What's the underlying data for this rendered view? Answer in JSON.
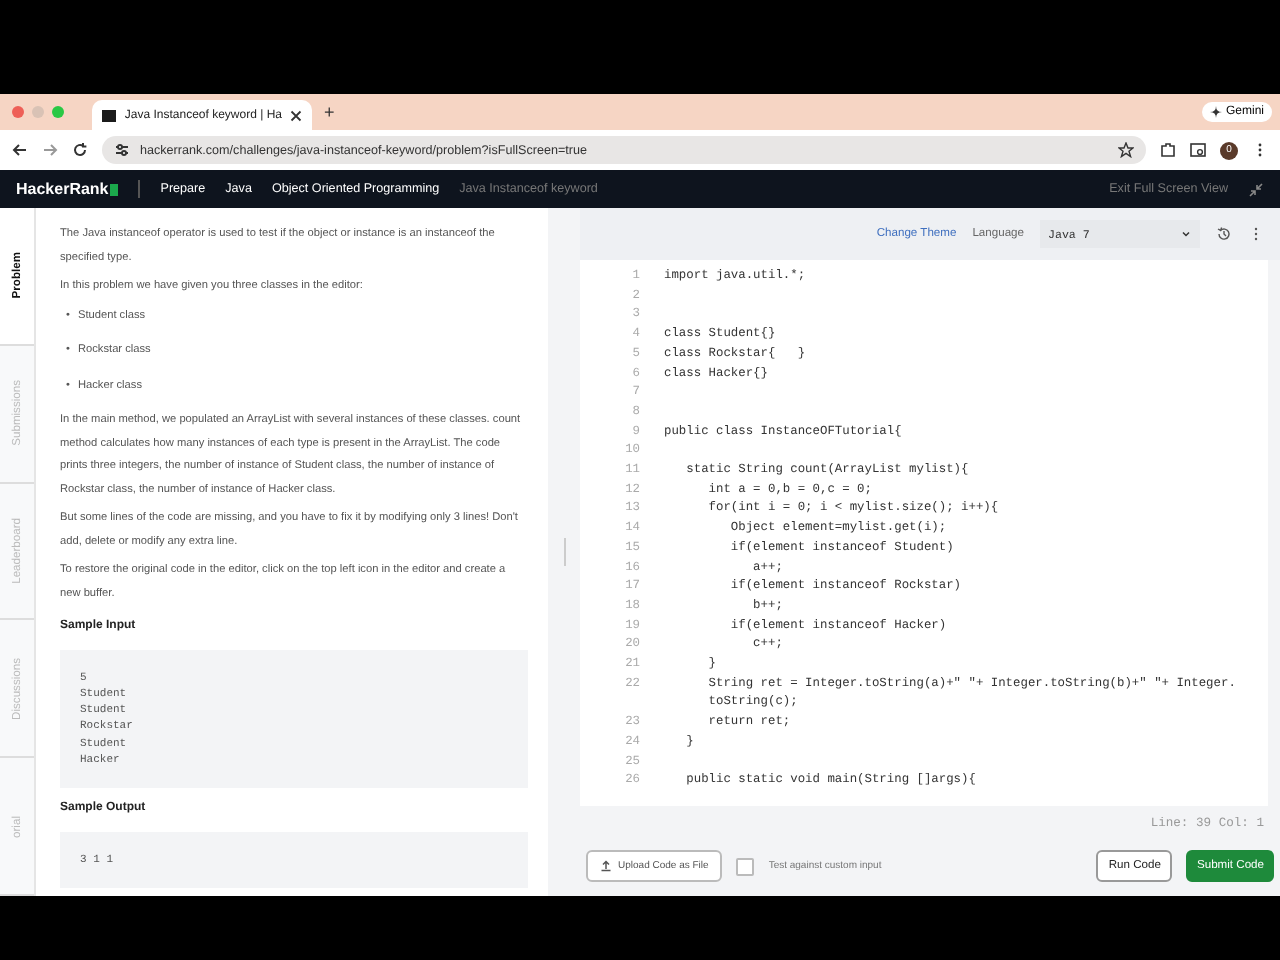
{
  "browser": {
    "tab_title": "Java Instanceof keyword | Ha",
    "new_tab": "+",
    "gemini": "Gemini",
    "url": "hackerrank.com/challenges/java-instanceof-keyword/problem?isFullScreen=true",
    "profile": "0"
  },
  "nav": {
    "logo": "HackerRank",
    "crumbs": [
      {
        "label": "Prepare",
        "current": false
      },
      {
        "label": "Java",
        "current": false
      },
      {
        "label": "Object Oriented Programming",
        "current": false
      },
      {
        "label": "Java Instanceof keyword",
        "current": true
      }
    ],
    "exit": "Exit Full Screen View"
  },
  "side_tabs": [
    {
      "label": "Problem",
      "selected": true
    },
    {
      "label": "Submissions",
      "selected": false
    },
    {
      "label": "Leaderboard",
      "selected": false
    },
    {
      "label": "Discussions",
      "selected": false
    },
    {
      "label": "orial",
      "selected": false
    }
  ],
  "problem": {
    "intro": "The Java instanceof operator is used to test if the object or instance is an instanceof the specified type.",
    "lead": "In this problem we have given you three classes in the editor:",
    "bullets": [
      {
        "marker": "•",
        "text": "Student class"
      },
      {
        "marker": "•",
        "text": "Rockstar class"
      },
      {
        "marker": "•",
        "text": "Hacker class"
      }
    ],
    "paragraphs": [
      "In the main method, we populated an ArrayList with several instances of these classes. count method calculates how many instances of each type is present in the ArrayList. The code prints three integers, the number of instance of Student class, the number of instance of Rockstar class, the number of instance of Hacker class.",
      "But some lines of the code are missing, and you have to fix it by modifying only 3 lines! Don't add, delete or modify any extra line.",
      "To restore the original code in the editor, click on the top left icon in the editor and create a new buffer."
    ],
    "sample_input_title": "Sample Input",
    "sample_input": [
      "5",
      "Student",
      "Student",
      "Rockstar",
      "Student",
      "Hacker"
    ],
    "sample_output_title": "Sample Output",
    "sample_output": [
      "3 1 1"
    ]
  },
  "editor": {
    "change_theme": "Change Theme",
    "language_label": "Language",
    "language": "Java 7",
    "lines": [
      {
        "n": "1",
        "code": "import java.util.*;"
      },
      {
        "n": "2"
      },
      {
        "n": "3"
      },
      {
        "n": "4",
        "code": "class Student{}"
      },
      {
        "n": "5",
        "code": "class Rockstar{   }"
      },
      {
        "n": "6",
        "code": "class Hacker{}"
      },
      {
        "n": "7"
      },
      {
        "n": "8"
      },
      {
        "n": "9",
        "code": "public class InstanceOFTutorial{"
      },
      {
        "n": "10"
      },
      {
        "n": "11",
        "code": "   static String count(ArrayList mylist){"
      },
      {
        "n": "12",
        "code": "      int a = 0,b = 0,c = 0;"
      },
      {
        "n": "13",
        "code": "      for(int i = 0; i < mylist.size(); i++){"
      },
      {
        "n": "14",
        "code": "         Object element=mylist.get(i);"
      },
      {
        "n": "15",
        "code": "         if(element instanceof Student)"
      },
      {
        "n": "16",
        "code": "            a++;"
      },
      {
        "n": "17",
        "code": "         if(element instanceof Rockstar)"
      },
      {
        "n": "18",
        "code": "            b++;"
      },
      {
        "n": "19",
        "code": "         if(element instanceof Hacker)"
      },
      {
        "n": "20",
        "code": "            c++;"
      },
      {
        "n": "21",
        "code": "      }"
      },
      {
        "n": "22",
        "code": "      String ret = Integer.toString(a)+\" \"+ Integer.toString(b)+\" \"+ Integer."
      },
      {
        "code": "      toString(c);"
      },
      {
        "n": "23",
        "code": "      return ret;"
      },
      {
        "n": "24",
        "code": "   }"
      },
      {
        "n": "25"
      },
      {
        "n": "26",
        "code": "   public static void main(String []args){"
      }
    ],
    "status": "Line: 39 Col: 1",
    "upload": "Upload Code as File",
    "custom_input": {
      "label": "Test against custom input",
      "checked": false
    },
    "run": "Run Code",
    "submit": "Submit Code"
  }
}
